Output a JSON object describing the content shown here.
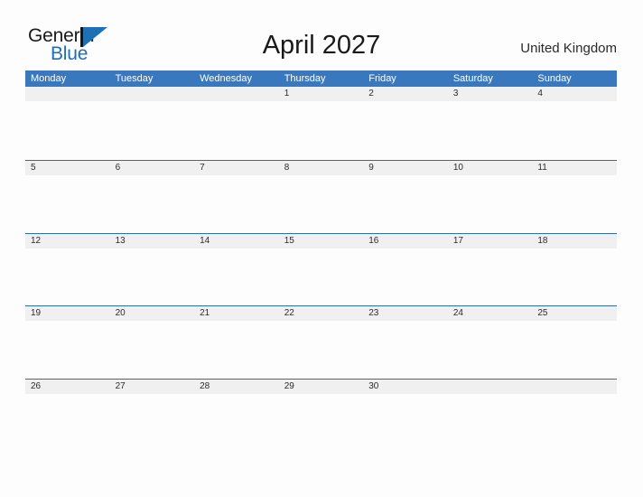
{
  "logo": {
    "text_primary": "General",
    "text_secondary": "Blue",
    "mark": "triangle-flag-icon",
    "color_primary": "#1a1a1a",
    "color_secondary": "#1f6fb5"
  },
  "header": {
    "title": "April 2027",
    "country": "United Kingdom"
  },
  "colors": {
    "header_blue": "#3a78be",
    "rule_blue": "#2f6ca8",
    "band_gray": "#f0f0f0",
    "page_background": "#fdfdfd",
    "text_dark": "#2b2b2b"
  },
  "calendar": {
    "month": "April",
    "year": "2027",
    "weekday_headers": [
      "Monday",
      "Tuesday",
      "Wednesday",
      "Thursday",
      "Friday",
      "Saturday",
      "Sunday"
    ],
    "weeks": [
      [
        "",
        "",
        "",
        "1",
        "2",
        "3",
        "4"
      ],
      [
        "5",
        "6",
        "7",
        "8",
        "9",
        "10",
        "11"
      ],
      [
        "12",
        "13",
        "14",
        "15",
        "16",
        "17",
        "18"
      ],
      [
        "19",
        "20",
        "21",
        "22",
        "23",
        "24",
        "25"
      ],
      [
        "26",
        "27",
        "28",
        "29",
        "30",
        "",
        ""
      ]
    ]
  }
}
